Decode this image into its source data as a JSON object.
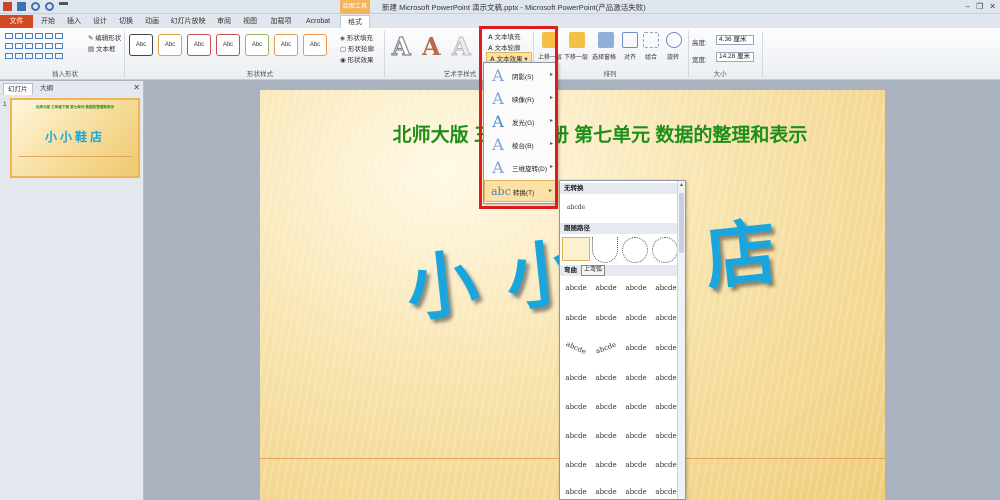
{
  "title_bar": {
    "title": "新建 Microsoft PowerPoint 演示文稿.pptx - Microsoft PowerPoint(产品激活失败)",
    "context_tab_label": "绘图工具"
  },
  "tabs": [
    "文件",
    "开始",
    "插入",
    "设计",
    "切换",
    "动画",
    "幻灯片放映",
    "审阅",
    "视图",
    "加载项",
    "Acrobat",
    "格式"
  ],
  "active_tab": "格式",
  "ribbon": {
    "insert_shapes": {
      "edit_shape": "编辑形状",
      "text_box": "文本框",
      "label": "插入形状"
    },
    "shape_styles": {
      "style_sample": "Abc",
      "fill": "形状填充",
      "outline": "形状轮廓",
      "effects": "形状效果",
      "label": "形状样式"
    },
    "wordart": {
      "glyph": "A",
      "text_fill": "文本填充",
      "text_outline": "文本轮廓",
      "text_effects": "文本效果",
      "label": "艺术字样式"
    },
    "arrange": {
      "bring_forward": "上移一层",
      "send_backward": "下移一层",
      "selection_pane": "选择窗格",
      "align": "对齐",
      "group": "组合",
      "rotate": "旋转",
      "label": "排列"
    },
    "size": {
      "height_label": "高度:",
      "height_value": "4.36 厘米",
      "width_label": "宽度:",
      "width_value": "14.28 厘米",
      "label": "大小"
    }
  },
  "left_pane": {
    "tab_slides": "幻灯片",
    "tab_outline": "大纲",
    "slide_number": "1",
    "thumb_title": "北师大版 三年级下册 第七单元 数据的整理和表示",
    "thumb_main": "小小鞋店"
  },
  "slide": {
    "title": "北师大版  三年级下册  第七单元  数据的整理和表示",
    "main_text": "小小鞋店"
  },
  "text_effects_menu": {
    "items": [
      {
        "label": "阴影(S)"
      },
      {
        "label": "映像(R)"
      },
      {
        "label": "发光(G)"
      },
      {
        "label": "棱台(B)"
      },
      {
        "label": "三维旋转(D)"
      },
      {
        "label": "转换(T)"
      }
    ],
    "highlighted": "转换(T)"
  },
  "transform_submenu": {
    "no_transform_header": "无转换",
    "no_transform_sample": "abcde",
    "follow_path_header": "跟随路径",
    "warp_header": "弯曲",
    "tooltip": "上弯弧",
    "sample": "abcde"
  }
}
